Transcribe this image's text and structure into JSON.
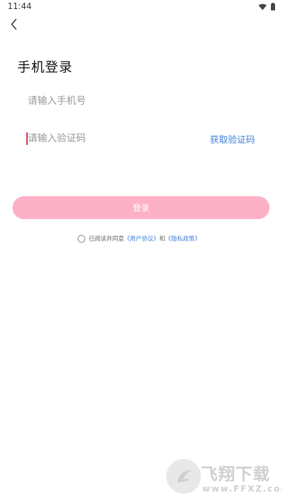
{
  "status_bar": {
    "time": "11:44",
    "icons": [
      "wifi-icon",
      "battery-icon"
    ]
  },
  "header": {
    "back_icon": "chevron-left-icon"
  },
  "title": "手机登录",
  "phone": {
    "placeholder": "请输入手机号"
  },
  "code": {
    "placeholder": "请输入验证码",
    "get_code_label": "获取验证码"
  },
  "login_button": "登录",
  "agreement": {
    "prefix": "已阅读并同意",
    "user_agreement": "《用户协议》",
    "and": "和",
    "privacy_policy": "《隐私政策》"
  },
  "watermark": {
    "logo": "brand-logo",
    "text": "飞翔下载",
    "sub": "www.FFXZ.com"
  },
  "colors": {
    "accent_pink": "#fdb1c6",
    "link_blue": "#3d7fd8",
    "caret": "#d0344f"
  }
}
